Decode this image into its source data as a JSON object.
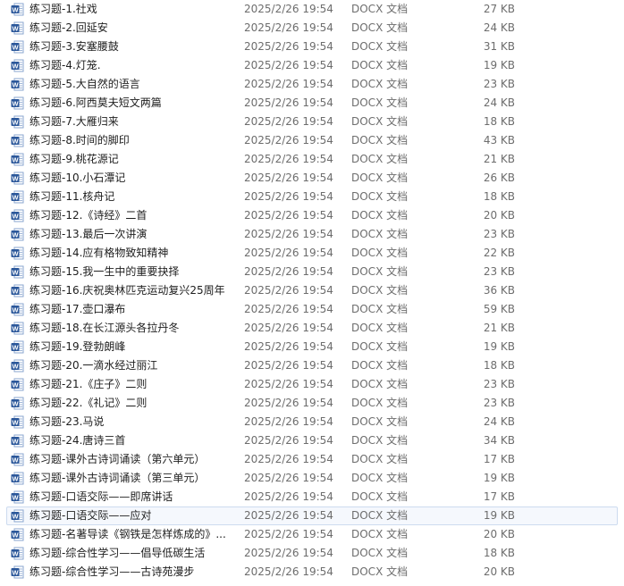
{
  "files": [
    {
      "name": "练习题-1.社戏",
      "date": "2025/2/26 19:54",
      "type": "DOCX 文档",
      "size": "27 KB"
    },
    {
      "name": "练习题-2.回延安",
      "date": "2025/2/26 19:54",
      "type": "DOCX 文档",
      "size": "24 KB"
    },
    {
      "name": "练习题-3.安塞腰鼓",
      "date": "2025/2/26 19:54",
      "type": "DOCX 文档",
      "size": "31 KB"
    },
    {
      "name": "练习题-4.灯笼.",
      "date": "2025/2/26 19:54",
      "type": "DOCX 文档",
      "size": "19 KB"
    },
    {
      "name": "练习题-5.大自然的语言",
      "date": "2025/2/26 19:54",
      "type": "DOCX 文档",
      "size": "23 KB"
    },
    {
      "name": "练习题-6.阿西莫夫短文两篇",
      "date": "2025/2/26 19:54",
      "type": "DOCX 文档",
      "size": "24 KB"
    },
    {
      "name": "练习题-7.大雁归来",
      "date": "2025/2/26 19:54",
      "type": "DOCX 文档",
      "size": "18 KB"
    },
    {
      "name": "练习题-8.时间的脚印",
      "date": "2025/2/26 19:54",
      "type": "DOCX 文档",
      "size": "43 KB"
    },
    {
      "name": "练习题-9.桃花源记",
      "date": "2025/2/26 19:54",
      "type": "DOCX 文档",
      "size": "21 KB"
    },
    {
      "name": "练习题-10.小石潭记",
      "date": "2025/2/26 19:54",
      "type": "DOCX 文档",
      "size": "26 KB"
    },
    {
      "name": "练习题-11.核舟记",
      "date": "2025/2/26 19:54",
      "type": "DOCX 文档",
      "size": "18 KB"
    },
    {
      "name": "练习题-12.《诗经》二首",
      "date": "2025/2/26 19:54",
      "type": "DOCX 文档",
      "size": "20 KB"
    },
    {
      "name": "练习题-13.最后一次讲演",
      "date": "2025/2/26 19:54",
      "type": "DOCX 文档",
      "size": "23 KB"
    },
    {
      "name": "练习题-14.应有格物致知精神",
      "date": "2025/2/26 19:54",
      "type": "DOCX 文档",
      "size": "22 KB"
    },
    {
      "name": "练习题-15.我一生中的重要抉择",
      "date": "2025/2/26 19:54",
      "type": "DOCX 文档",
      "size": "23 KB"
    },
    {
      "name": "练习题-16.庆祝奥林匹克运动复兴25周年",
      "date": "2025/2/26 19:54",
      "type": "DOCX 文档",
      "size": "36 KB"
    },
    {
      "name": "练习题-17.壶口瀑布",
      "date": "2025/2/26 19:54",
      "type": "DOCX 文档",
      "size": "59 KB"
    },
    {
      "name": "练习题-18.在长江源头各拉丹冬",
      "date": "2025/2/26 19:54",
      "type": "DOCX 文档",
      "size": "21 KB"
    },
    {
      "name": "练习题-19.登勃朗峰",
      "date": "2025/2/26 19:54",
      "type": "DOCX 文档",
      "size": "19 KB"
    },
    {
      "name": "练习题-20.一滴水经过丽江",
      "date": "2025/2/26 19:54",
      "type": "DOCX 文档",
      "size": "18 KB"
    },
    {
      "name": "练习题-21.《庄子》二则",
      "date": "2025/2/26 19:54",
      "type": "DOCX 文档",
      "size": "23 KB"
    },
    {
      "name": "练习题-22.《礼记》二则",
      "date": "2025/2/26 19:54",
      "type": "DOCX 文档",
      "size": "23 KB"
    },
    {
      "name": "练习题-23.马说",
      "date": "2025/2/26 19:54",
      "type": "DOCX 文档",
      "size": "24 KB"
    },
    {
      "name": "练习题-24.唐诗三首",
      "date": "2025/2/26 19:54",
      "type": "DOCX 文档",
      "size": "34 KB"
    },
    {
      "name": "练习题-课外古诗词诵读（第六单元）",
      "date": "2025/2/26 19:54",
      "type": "DOCX 文档",
      "size": "17 KB"
    },
    {
      "name": "练习题-课外古诗词诵读（第三单元）",
      "date": "2025/2/26 19:54",
      "type": "DOCX 文档",
      "size": "19 KB"
    },
    {
      "name": "练习题-口语交际——即席讲话",
      "date": "2025/2/26 19:54",
      "type": "DOCX 文档",
      "size": "17 KB"
    },
    {
      "name": "练习题-口语交际——应对",
      "date": "2025/2/26 19:54",
      "type": "DOCX 文档",
      "size": "19 KB",
      "selected": true
    },
    {
      "name": "练习题-名著导读《钢铁是怎样炼成的》...",
      "date": "2025/2/26 19:54",
      "type": "DOCX 文档",
      "size": "20 KB"
    },
    {
      "name": "练习题-综合性学习——倡导低碳生活",
      "date": "2025/2/26 19:54",
      "type": "DOCX 文档",
      "size": "18 KB"
    },
    {
      "name": "练习题-综合性学习——古诗苑漫步",
      "date": "2025/2/26 19:54",
      "type": "DOCX 文档",
      "size": "20 KB"
    }
  ],
  "icon": {
    "name": "word-doc-icon",
    "color": "#2b579a"
  },
  "colors": {
    "selected_bg": "#f5f8fd",
    "selected_border": "#cddbef",
    "meta_text": "#6d6d6d"
  }
}
